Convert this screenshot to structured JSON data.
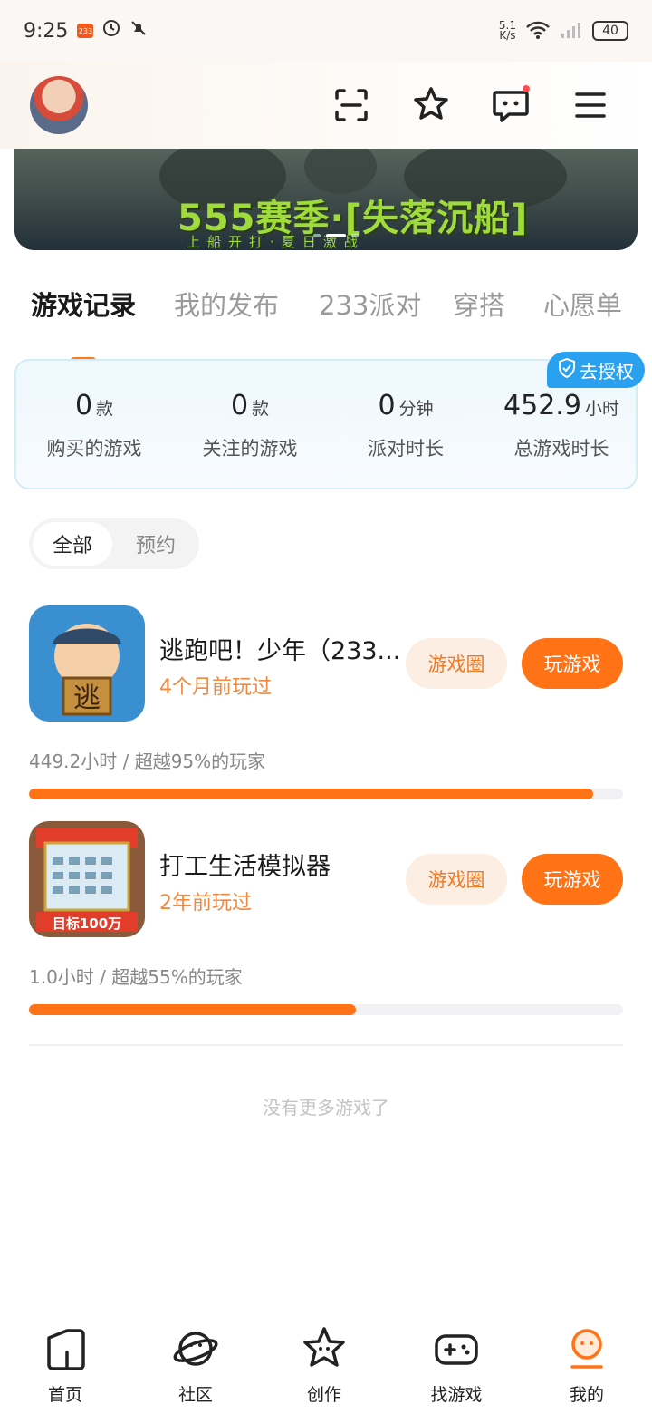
{
  "status_bar": {
    "time": "9:25",
    "app_badge": "233",
    "net_speed": "5.1\nK/s",
    "battery": "40"
  },
  "banner": {
    "title": "555赛季·[失落沉船]",
    "subtitle": "上船开打·夏日激战"
  },
  "tabs": [
    "游戏记录",
    "我的发布",
    "233派对",
    "穿搭",
    "心愿单"
  ],
  "stats": {
    "auth_badge": "去授权",
    "items": [
      {
        "value": "0",
        "unit": "款",
        "label": "购买的游戏"
      },
      {
        "value": "0",
        "unit": "款",
        "label": "关注的游戏"
      },
      {
        "value": "0",
        "unit": "分钟",
        "label": "派对时长"
      },
      {
        "value": "452.9",
        "unit": "小时",
        "label": "总游戏时长"
      }
    ]
  },
  "filter": {
    "all": "全部",
    "reserve": "预约"
  },
  "games": [
    {
      "name": "逃跑吧！少年（233...",
      "last_played": "4个月前玩过",
      "circle_btn": "游戏圈",
      "play_btn": "玩游戏",
      "stat": "449.2小时 / 超越95%的玩家",
      "progress": 0.95,
      "icon_text": "逃"
    },
    {
      "name": "打工生活模拟器",
      "last_played": "2年前玩过",
      "circle_btn": "游戏圈",
      "play_btn": "玩游戏",
      "stat": "1.0小时 / 超越55%的玩家",
      "progress": 0.55,
      "icon_text": "目标100万"
    }
  ],
  "footer_text": "没有更多游戏了",
  "bottom_nav": [
    {
      "label": "首页",
      "icon": "home-icon"
    },
    {
      "label": "社区",
      "icon": "planet-icon"
    },
    {
      "label": "创作",
      "icon": "star-icon"
    },
    {
      "label": "找游戏",
      "icon": "gamepad-icon"
    },
    {
      "label": "我的",
      "icon": "profile-icon"
    }
  ],
  "colors": {
    "accent": "#ff7216",
    "accent_light": "#fdeee4",
    "auth_blue": "#2aa0f0"
  }
}
